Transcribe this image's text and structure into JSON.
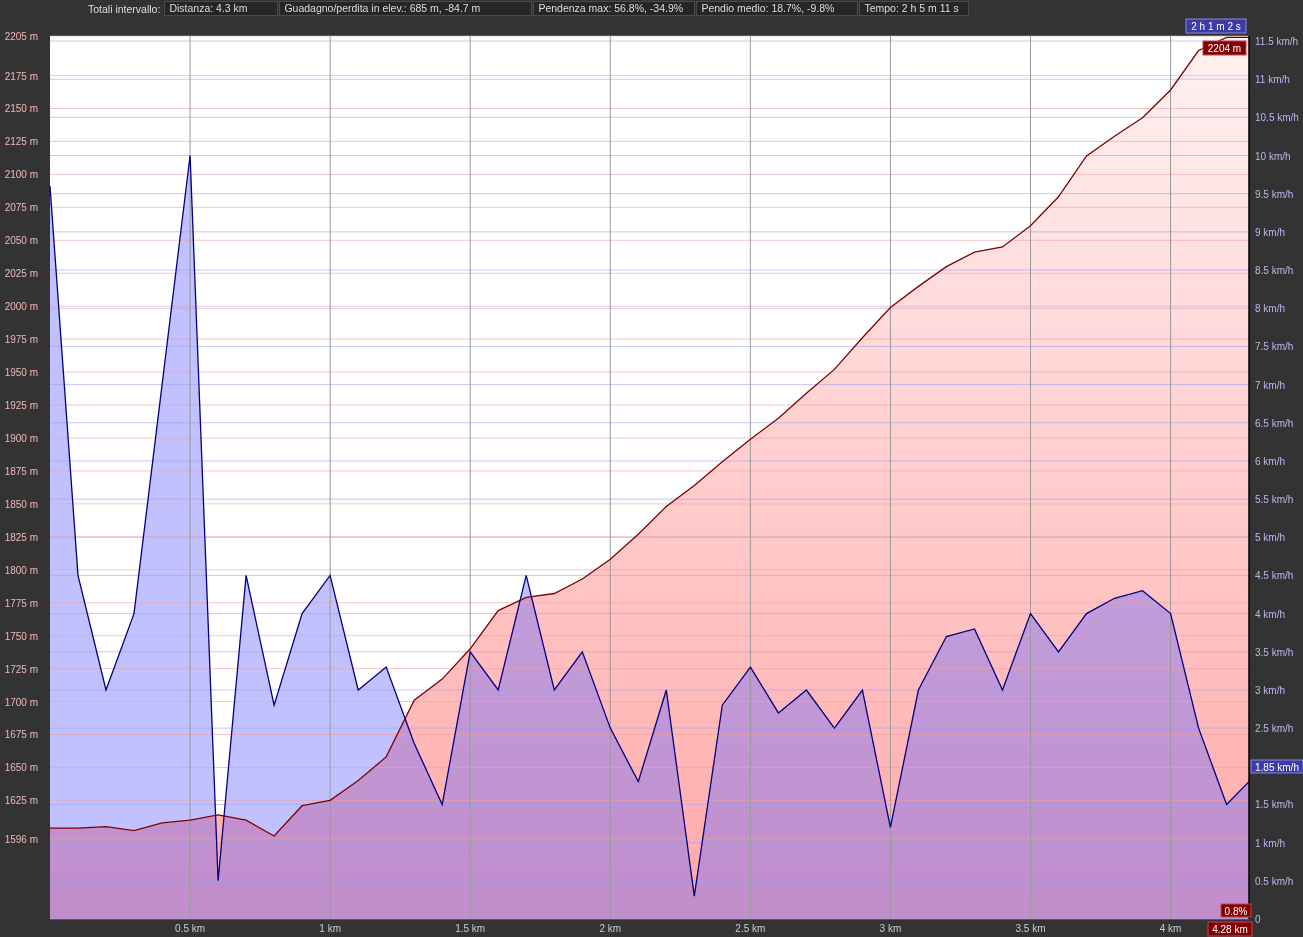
{
  "summary": {
    "label": "Totali intervallo:",
    "fields": [
      "Distanza: 4.3 km",
      "Guadagno/perdita in elev.: 685 m, -84.7 m",
      "Pendenza max: 56.8%, -34.9%",
      "Pendio medio: 18.7%, -9.8%",
      "Tempo: 2 h 5 m 11 s"
    ]
  },
  "cursor": {
    "time": "2 h 1 m 2 s",
    "elevation": "2204 m",
    "speed": "1.85 km/h",
    "grade": "0.8%",
    "distance": "4.28 km"
  },
  "chart": {
    "chart_data": {
      "type": "area",
      "x": [
        0,
        0.1,
        0.2,
        0.3,
        0.4,
        0.5,
        0.6,
        0.7,
        0.8,
        0.9,
        1.0,
        1.1,
        1.2,
        1.3,
        1.4,
        1.5,
        1.6,
        1.7,
        1.8,
        1.9,
        2.0,
        2.1,
        2.2,
        2.3,
        2.4,
        2.5,
        2.6,
        2.7,
        2.8,
        2.9,
        3.0,
        3.1,
        3.2,
        3.3,
        3.4,
        3.5,
        3.6,
        3.7,
        3.8,
        3.9,
        4.0,
        4.1,
        4.2,
        4.28
      ],
      "series": [
        {
          "color": "#800000",
          "values": [
            1604,
            1604,
            1605,
            1602,
            1608,
            1610,
            1614,
            1610,
            1598,
            1621,
            1625,
            1640,
            1658,
            1701,
            1717,
            1740,
            1769,
            1779,
            1782,
            1793,
            1808,
            1827,
            1848,
            1864,
            1882,
            1899,
            1915,
            1934,
            1952,
            1976,
            1999,
            2015,
            2030,
            2041,
            2045,
            2061,
            2083,
            2114,
            2129,
            2143,
            2164,
            2194,
            2204,
            2204
          ]
        },
        {
          "color": "#000080",
          "axis": "y2",
          "values": [
            9.6,
            4.5,
            3.0,
            4.0,
            7.0,
            10.0,
            0.5,
            4.5,
            2.8,
            4.0,
            4.5,
            3.0,
            3.3,
            2.3,
            1.5,
            3.5,
            3.0,
            4.5,
            3.0,
            3.5,
            2.5,
            1.8,
            3.0,
            0.3,
            2.8,
            3.3,
            2.7,
            3.0,
            2.5,
            3.0,
            1.2,
            3.0,
            3.7,
            3.8,
            3.0,
            4.0,
            3.5,
            4.0,
            4.2,
            4.3,
            4.0,
            2.5,
            1.5,
            1.8
          ]
        }
      ],
      "grid": true,
      "xlim": [
        0,
        4.28
      ],
      "ylim": [
        1535,
        2205
      ],
      "y2lim": [
        0,
        11.5
      ],
      "xticks": [
        {
          "value": 0.5,
          "label": "0.5 km"
        },
        {
          "value": 1,
          "label": "1 km"
        },
        {
          "value": 1.5,
          "label": "1.5 km"
        },
        {
          "value": 2,
          "label": "2 km"
        },
        {
          "value": 2.5,
          "label": "2.5 km"
        },
        {
          "value": 3,
          "label": "3 km"
        },
        {
          "value": 3.5,
          "label": "3.5 km"
        },
        {
          "value": 4,
          "label": "4 km"
        }
      ],
      "yticks": [
        {
          "value": 2205,
          "label": "2205 m"
        },
        {
          "value": 2175,
          "label": "2175 m"
        },
        {
          "value": 2150,
          "label": "2150 m"
        },
        {
          "value": 2125,
          "label": "2125 m"
        },
        {
          "value": 2100,
          "label": "2100 m"
        },
        {
          "value": 2075,
          "label": "2075 m"
        },
        {
          "value": 2050,
          "label": "2050 m"
        },
        {
          "value": 2025,
          "label": "2025 m"
        },
        {
          "value": 2000,
          "label": "2000 m"
        },
        {
          "value": 1975,
          "label": "1975 m"
        },
        {
          "value": 1950,
          "label": "1950 m"
        },
        {
          "value": 1925,
          "label": "1925 m"
        },
        {
          "value": 1900,
          "label": "1900 m"
        },
        {
          "value": 1875,
          "label": "1875 m"
        },
        {
          "value": 1850,
          "label": "1850 m"
        },
        {
          "value": 1825,
          "label": "1825 m"
        },
        {
          "value": 1800,
          "label": "1800 m"
        },
        {
          "value": 1775,
          "label": "1775 m"
        },
        {
          "value": 1750,
          "label": "1750 m"
        },
        {
          "value": 1725,
          "label": "1725 m"
        },
        {
          "value": 1700,
          "label": "1700 m"
        },
        {
          "value": 1675,
          "label": "1675 m"
        },
        {
          "value": 1650,
          "label": "1650 m"
        },
        {
          "value": 1625,
          "label": "1625 m"
        },
        {
          "value": 1596,
          "label": "1596 m"
        }
      ],
      "y2ticks": [
        {
          "value": 11.5,
          "label": "11.5 km/h"
        },
        {
          "value": 11,
          "label": "11 km/h"
        },
        {
          "value": 10.5,
          "label": "10.5 km/h"
        },
        {
          "value": 10,
          "label": "10 km/h"
        },
        {
          "value": 9.5,
          "label": "9.5 km/h"
        },
        {
          "value": 9,
          "label": "9 km/h"
        },
        {
          "value": 8.5,
          "label": "8.5 km/h"
        },
        {
          "value": 8,
          "label": "8 km/h"
        },
        {
          "value": 7.5,
          "label": "7.5 km/h"
        },
        {
          "value": 7,
          "label": "7 km/h"
        },
        {
          "value": 6.5,
          "label": "6.5 km/h"
        },
        {
          "value": 6,
          "label": "6 km/h"
        },
        {
          "value": 5.5,
          "label": "5.5 km/h"
        },
        {
          "value": 5,
          "label": "5 km/h"
        },
        {
          "value": 4.5,
          "label": "4.5 km/h"
        },
        {
          "value": 4,
          "label": "4 km/h"
        },
        {
          "value": 3.5,
          "label": "3.5 km/h"
        },
        {
          "value": 3,
          "label": "3 km/h"
        },
        {
          "value": 2.5,
          "label": "2.5 km/h"
        },
        {
          "value": 1.5,
          "label": "1.5 km/h"
        },
        {
          "value": 1,
          "label": "1 km/h"
        },
        {
          "value": 0.5,
          "label": "0.5 km/h"
        },
        {
          "value": 0,
          "label": "0"
        }
      ]
    }
  }
}
